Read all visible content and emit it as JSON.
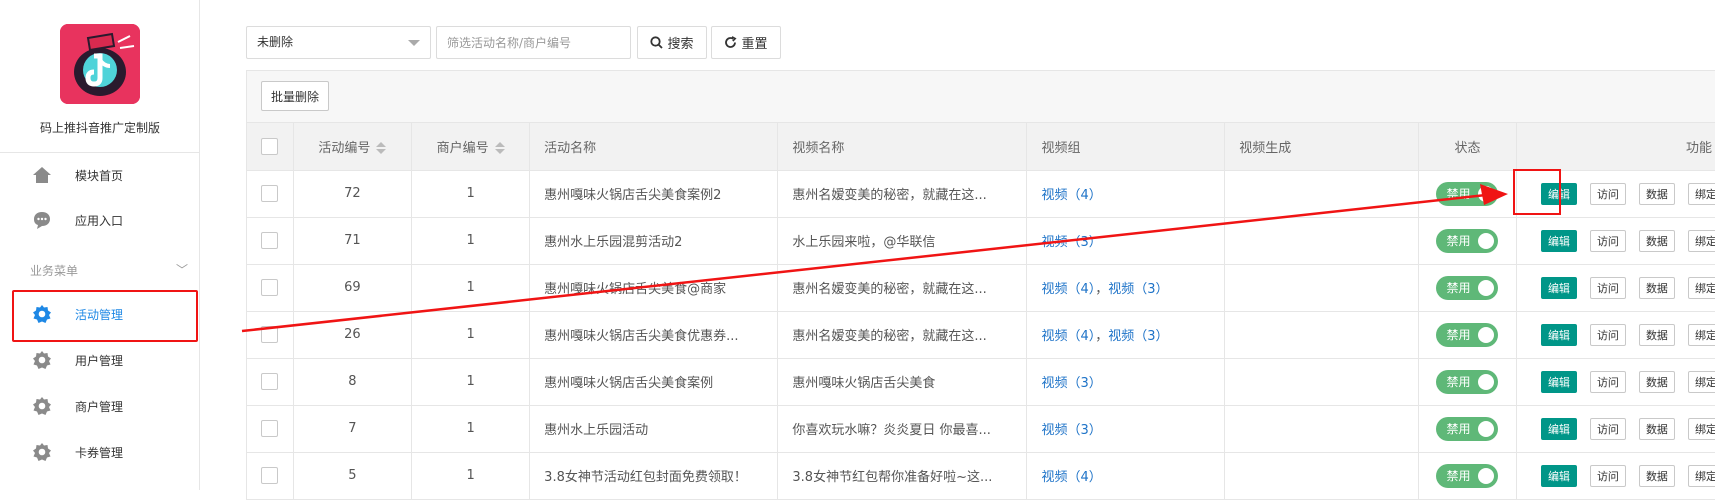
{
  "sidebar": {
    "app_name": "码上推抖音推广定制版",
    "items_top": [
      {
        "label": "模块首页",
        "icon": "home-icon"
      },
      {
        "label": "应用入口",
        "icon": "chat-icon"
      }
    ],
    "section_label": "业务菜单",
    "items_business": [
      {
        "label": "活动管理",
        "icon": "gear-icon",
        "active": true
      },
      {
        "label": "用户管理",
        "icon": "gear-icon"
      },
      {
        "label": "商户管理",
        "icon": "gear-icon"
      },
      {
        "label": "卡券管理",
        "icon": "gear-icon"
      }
    ]
  },
  "filters": {
    "status_select": "未删除",
    "search_placeholder": "筛选活动名称/商户编号",
    "search_button": "搜索",
    "reset_button": "重置"
  },
  "table": {
    "batch_delete": "批量删除",
    "headers": [
      "活动编号",
      "商户编号",
      "活动名称",
      "视频名称",
      "视频组",
      "视频生成",
      "状态",
      "功能"
    ],
    "status_label": "禁用",
    "actions": [
      "编辑",
      "访问",
      "数据",
      "绑定"
    ],
    "rows": [
      {
        "id": "72",
        "merchant": "1",
        "name": "惠州嘎味火锅店舌尖美食案例2",
        "video": "惠州名嫒变美的秘密，就藏在这...",
        "groups": [
          "视频（4）"
        ]
      },
      {
        "id": "71",
        "merchant": "1",
        "name": "惠州水上乐园混剪活动2",
        "video": "水上乐园来啦，@华联信",
        "groups": [
          "视频（3）"
        ]
      },
      {
        "id": "69",
        "merchant": "1",
        "name": "惠州嘎味火锅店舌尖美食@商家",
        "video": "惠州名嫒变美的秘密，就藏在这...",
        "groups": [
          "视频（4）",
          "视频（3）"
        ]
      },
      {
        "id": "26",
        "merchant": "1",
        "name": "惠州嘎味火锅店舌尖美食优惠券...",
        "video": "惠州名嫒变美的秘密，就藏在这...",
        "groups": [
          "视频（4）",
          "视频（3）"
        ]
      },
      {
        "id": "8",
        "merchant": "1",
        "name": "惠州嘎味火锅店舌尖美食案例",
        "video": "惠州嘎味火锅店舌尖美食",
        "groups": [
          "视频（3）"
        ]
      },
      {
        "id": "7",
        "merchant": "1",
        "name": "惠州水上乐园活动",
        "video": "你喜欢玩水嘛？炎炎夏日 你最喜...",
        "groups": [
          "视频（3）"
        ]
      },
      {
        "id": "5",
        "merchant": "1",
        "name": "3.8女神节活动红包封面免费领取！",
        "video": "3.8女神节红包帮你准备好啦~这...",
        "groups": [
          "视频（4）"
        ]
      }
    ]
  },
  "colors": {
    "accent": "#1e88e5",
    "primary_button": "#009688",
    "toggle": "#5fb878",
    "annotation": "#f01414"
  }
}
